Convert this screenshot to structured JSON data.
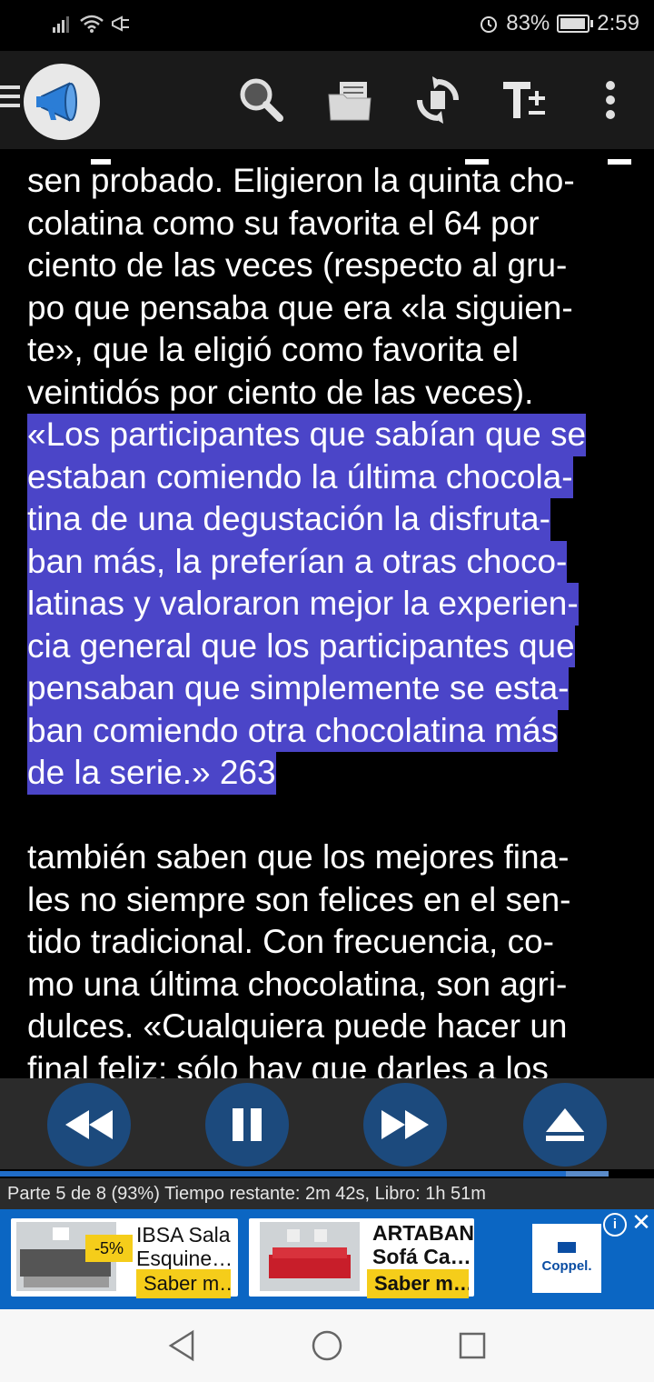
{
  "status_bar": {
    "battery": "83%",
    "battery_level": 0.83,
    "time": "2:59"
  },
  "toolbar": {
    "icons": [
      "menu-icon",
      "megaphone-icon",
      "search-icon",
      "folder-icon",
      "sync-icon",
      "text-size-icon",
      "more-vert-icon"
    ]
  },
  "reader": {
    "para1_lines": [
      "sen probado. Eligieron la quinta cho-",
      "colatina como su favorita el 64 por",
      "ciento de las veces (respecto al gru-",
      "po que pensaba que era «la siguien-",
      "te», que la eligió como favorita el",
      "veintidós por ciento de las veces)."
    ],
    "highlight_lines": [
      "«Los participantes que sabían que se",
      "estaban comiendo la última chocola-",
      "tina de una degustación la disfruta-",
      "ban más, la preferían a otras choco-",
      "latinas y valoraron mejor la experien-",
      "cia general que los participantes que",
      "pensaban que simplemente se esta-",
      "ban comiendo otra chocolatina más",
      "de la serie.» 263"
    ],
    "para2_lines": [
      "también saben que los mejores fina-",
      "les no siempre son felices en el sen-",
      "tido tradicional. Con frecuencia, co-",
      "mo una última chocolatina, son agri-",
      "dulces. «Cualquiera puede hacer un",
      "final feliz: sólo hay que darles a los"
    ],
    "highlight_color": "#4b45c8"
  },
  "player": {
    "buttons": [
      "rewind-icon",
      "pause-icon",
      "fast-forward-icon",
      "eject-icon"
    ],
    "progress_fraction": 0.93,
    "info": "Parte 5 de 8 (93%)   Tiempo restante: 2m 42s,   Libro: 1h 51m"
  },
  "ad": {
    "card1": {
      "badge": "-5%",
      "title_line1": "IBSA Sala",
      "title_line2": "Esquine…",
      "button": "Saber m…"
    },
    "card2": {
      "title_line1": "ARTABAN",
      "title_line2": "Sofá Ca…",
      "button": "Saber m…"
    },
    "brand": "Coppel.",
    "info_label": "i",
    "close_label": "✕"
  },
  "nav": {
    "icons": [
      "back-icon",
      "home-icon",
      "recents-icon"
    ]
  },
  "colors": {
    "accent_blue": "#1c4a7d",
    "ad_blue": "#0b66c3",
    "button_yellow": "#f5cd1a"
  }
}
